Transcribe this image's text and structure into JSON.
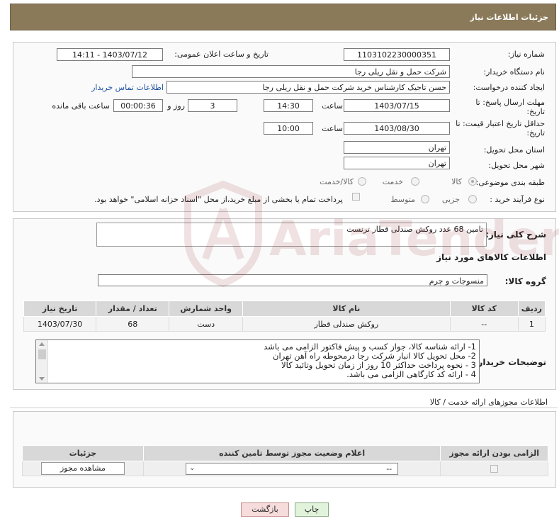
{
  "header": {
    "title": "جزئیات اطلاعات نیاز"
  },
  "form": {
    "need_number": {
      "label": "شماره نیاز:",
      "value": "1103102230000351"
    },
    "announce": {
      "label": "تاریخ و ساعت اعلان عمومی:",
      "value": "1403/07/12 - 14:11"
    },
    "buyer_org": {
      "label": "نام دستگاه خریدار:",
      "value": "شرکت حمل و نقل ریلی رجا"
    },
    "requester": {
      "label": "ایجاد کننده درخواست:",
      "value": "حسن تاجیک کارشناس خرید شرکت حمل و نقل ریلی رجا",
      "contact_link": "اطلاعات تماس خریدار"
    },
    "reply_deadline": {
      "label": "مهلت ارسال پاسخ: تا تاریخ:",
      "date": "1403/07/15",
      "time_label": "ساعت",
      "time": "14:30",
      "days": "3",
      "days_label": "روز و",
      "remaining": "00:00:36",
      "remaining_label": "ساعت باقی مانده"
    },
    "price_validity": {
      "label": "حداقل تاریخ اعتبار قیمت: تا تاریخ:",
      "date": "1403/08/30",
      "time_label": "ساعت",
      "time": "10:00"
    },
    "province": {
      "label": "استان محل تحویل:",
      "value": "تهران"
    },
    "city": {
      "label": "شهر محل تحویل:",
      "value": "تهران"
    },
    "category": {
      "label": "طبقه بندی موضوعی:",
      "options": [
        "کالا",
        "خدمت",
        "کالا/خدمت"
      ],
      "selected": "کالا"
    },
    "purchase_type": {
      "label": "نوع فرآیند خرید :",
      "options": [
        "جزیی",
        "متوسط"
      ],
      "treasury_note": "پرداخت تمام یا بخشی از مبلغ خرید،از محل \"اسناد خزانه اسلامی\" خواهد بود."
    }
  },
  "description": {
    "label": "شرح کلی نیاز:",
    "value": "تامین 68 عدد روکش صندلی قطار ترنست"
  },
  "goods_section": {
    "title": "اطلاعات کالاهای مورد نیاز"
  },
  "goods_group": {
    "label": "گروه کالا:",
    "value": "منسوجات و چرم"
  },
  "goods_table": {
    "headers": [
      "ردیف",
      "کد کالا",
      "نام کالا",
      "واحد شمارش",
      "تعداد / مقدار",
      "تاریخ نیاز"
    ],
    "rows": [
      [
        "1",
        "--",
        "روکش صندلی قطار",
        "دست",
        "68",
        "1403/07/30"
      ]
    ]
  },
  "buyer_notes": {
    "label": "توضیحات خریدار:",
    "lines": [
      "1- ارائه شناسه کالا، جواز کسب و پیش فاکتور الزامی می باشد",
      "2- محل تحویل کالا انبار شرکت رجا درمحوطه راه آهن تهران",
      "3 - نحوه پرداخت حداکثر 10 روز از زمان تحویل وتائید کالا",
      "4 - ارائه کد کارگاهی الزامی می باشد."
    ]
  },
  "permits": {
    "title": "اطلاعات مجوزهای ارائه خدمت / کالا",
    "headers": [
      "الزامی بودن ارائه مجوز",
      "اعلام وضعیت مجوز توسط تامین کننده",
      "جزئیات"
    ],
    "select_value": "--",
    "view_button": "مشاهده مجوز"
  },
  "buttons": {
    "print": "چاپ",
    "back": "بازگشت"
  },
  "watermark_text": "AriaTender.neT",
  "colors": {
    "header_bg": "#8b7a5a",
    "link": "#1a4fa0",
    "back_bg": "#f7dcdc",
    "print_bg": "#e2f3dc"
  }
}
